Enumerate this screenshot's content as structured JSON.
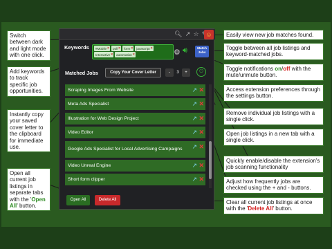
{
  "browser": {
    "ext_icon": "extension-badge-icon"
  },
  "popup": {
    "keywords_label": "Keywords",
    "keywords": [
      "#Mobile",
      "poll",
      "form",
      "javascript",
      "Interactive",
      "automation"
    ],
    "match_button": "Match Jobs",
    "matched_jobs_label": "Matched Jobs",
    "copy_button": "Copy Your Cover Letter",
    "stepper": {
      "minus": "-",
      "value": "3",
      "plus": "+"
    },
    "jobs": [
      "Scraping Images From Website",
      "Meta Ads Specialist",
      "Illustration for Web Design Project",
      "Video Editor",
      "Google Ads Specialist for Local Advertising Campaigns",
      "Video Unreal Engine",
      "Short form clipper"
    ],
    "open_all": "Open All",
    "delete_all": "Delete All"
  },
  "notes": {
    "n1": "Switch between dark and light mode with one click.",
    "n2": "Add keywords to track specific job opportunities.",
    "n3": "Instantly copy your saved cover letter to the clipboard for immediate use.",
    "n4a": "Open all current job listings in separate tabs with the '",
    "n4b": "Open All",
    "n4c": "' button.",
    "r1": "Easily view new job matches found.",
    "r2": "Toggle between all job listings and keyword-matched jobs.",
    "r3a": "Toggle notifications ",
    "r3on": "on",
    "r3sep": "/",
    "r3off": "off",
    "r3b": " with the mute/unmute button.",
    "r4": "Access extension preferences through the settings button.",
    "r5": "Remove individual job listings with a single click.",
    "r6": "Open job listings in a new tab with a single click.",
    "r7": "Quickly enable/disable the extension's job scanning functionality",
    "r8": "Adjust how frequently jobs are checked using the + and - buttons.",
    "r9a": "Clear all current job listings at once with the '",
    "r9b": "Delete All",
    "r9c": "' button."
  },
  "colors": {
    "accent_green": "#2e8b22",
    "accent_red": "#d42020",
    "background": "#2a5a20"
  }
}
